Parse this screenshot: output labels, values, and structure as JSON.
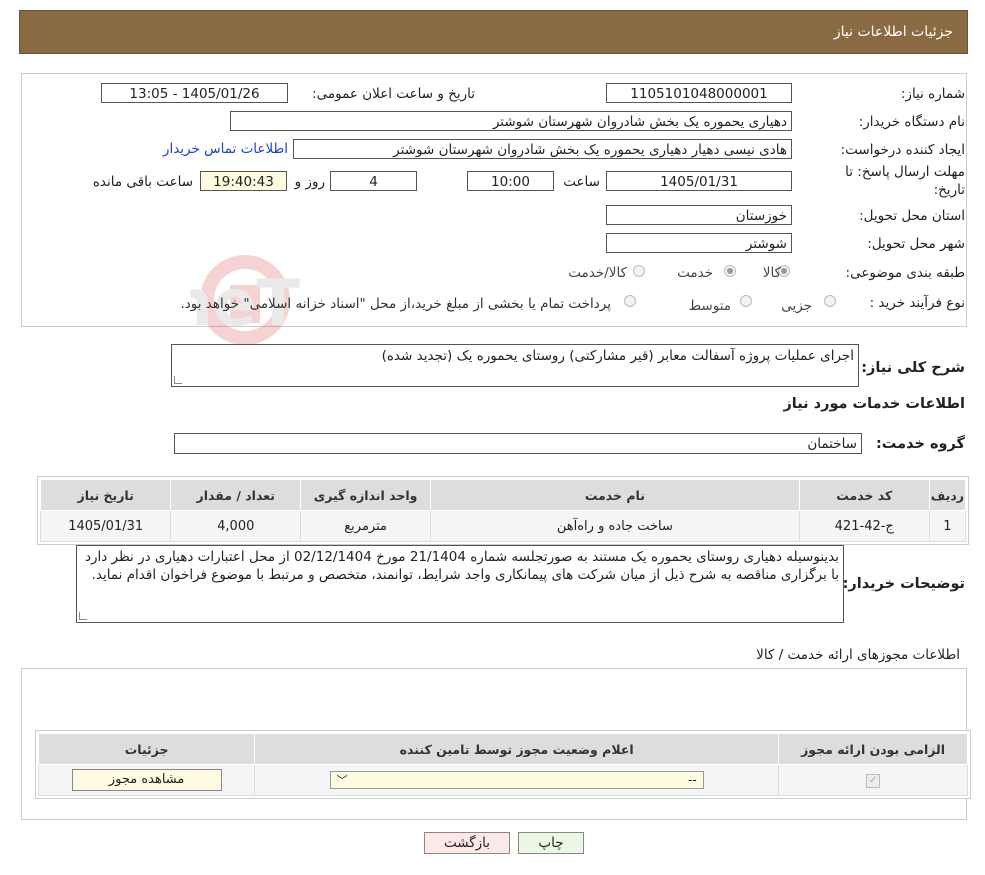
{
  "header": {
    "title": "جزئیات اطلاعات نیاز"
  },
  "form": {
    "need_number_label": "شماره نیاز:",
    "need_number": "1105101048000001",
    "announce_label": "تاریخ و ساعت اعلان عمومی:",
    "announce_value": "1405/01/26 - 13:05",
    "buyer_org_label": "نام دستگاه خریدار:",
    "buyer_org": "دهیاری یحموره یک بخش شادروان شهرستان شوشتر",
    "requester_label": "ایجاد کننده درخواست:",
    "requester": "هادی نیسی دهیار دهیاری یحموره یک بخش شادروان شهرستان شوشتر",
    "contact_link": "اطلاعات تماس خریدار",
    "deadline_label": "مهلت ارسال پاسخ: تا تاریخ:",
    "deadline_date": "1405/01/31",
    "time_label": "ساعت",
    "deadline_time": "10:00",
    "days_value": "4",
    "days_label": "روز و",
    "remaining_time": "19:40:43",
    "remaining_label": "ساعت باقی مانده",
    "province_label": "استان محل تحویل:",
    "province": "خوزستان",
    "city_label": "شهر محل تحویل:",
    "city": "شوشتر",
    "category_label": "طبقه بندی موضوعی:",
    "category_options": [
      "کالا",
      "خدمت",
      "کالا/خدمت"
    ],
    "process_label": "نوع فرآیند خرید :",
    "process_options": [
      "جزیی",
      "متوسط"
    ],
    "process_note": "پرداخت تمام یا بخشی از مبلغ خرید،از محل \"اسناد خزانه اسلامی\" خواهد بود."
  },
  "summary": {
    "label": "شرح کلی نیاز:",
    "text": "اجرای عملیات پروژه آسفالت معابر (قیر مشارکتی) روستای یحموره یک (تجدید شده)"
  },
  "services": {
    "section_title": "اطلاعات خدمات مورد نیاز",
    "group_label": "گروه خدمت:",
    "group_value": "ساختمان",
    "columns": [
      "ردیف",
      "کد خدمت",
      "نام خدمت",
      "واحد اندازه گیری",
      "تعداد / مقدار",
      "تاریخ نیاز"
    ],
    "rows": [
      [
        "1",
        "ج-42-421",
        "ساخت جاده و راه‌آهن",
        "مترمربع",
        "4,000",
        "1405/01/31"
      ]
    ]
  },
  "buyer_notes": {
    "label": "توضیحات خریدار:",
    "text": "بدینوسیله دهیاری روستای یحموره یک مستند به صورتجلسه شماره 21/1404 مورخ 02/12/1404 از محل اعتبارات دهیاری در نظر دارد با برگزاری مناقصه به شرح ذیل از میان شرکت های پیمانکاری واجد شرایط، توانمند، متخصص و مرتبط با موضوع فراخوان اقدام نماید."
  },
  "permits": {
    "section_title": "اطلاعات مجوزهای ارائه خدمت / کالا",
    "columns": [
      "الزامی بودن ارائه مجوز",
      "اعلام وضعیت مجوز توسط تامین کننده",
      "جزئیات"
    ],
    "select_value": "--",
    "view_button": "مشاهده مجوز"
  },
  "buttons": {
    "print": "چاپ",
    "back": "بازگشت"
  },
  "watermark": {
    "text": "AriaTender.neT"
  },
  "colors": {
    "header_bg": "#8a6a43",
    "link": "#1a44c8",
    "back_button_bg": "#fde8e8",
    "print_button_bg": "#eaf7e4"
  }
}
